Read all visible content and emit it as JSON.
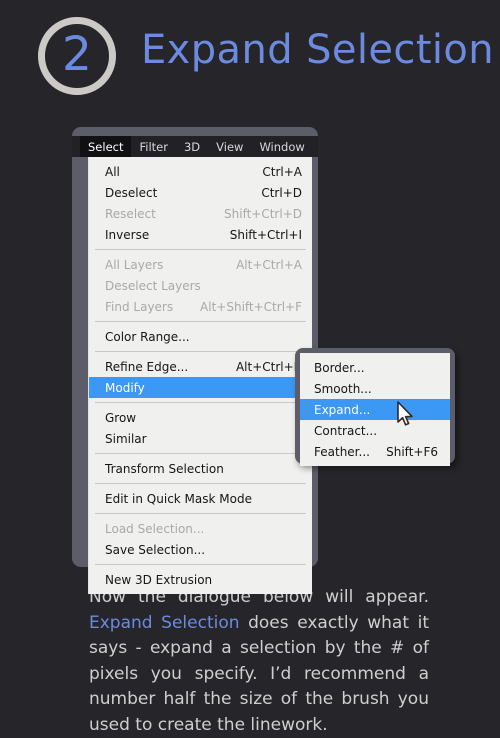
{
  "header": {
    "step_number": "2",
    "title": "Expand Selection",
    "accent_color": "#6c8be0",
    "ring_color": "#cccac6"
  },
  "window": {
    "menubar": [
      {
        "label": "Select",
        "active": true
      },
      {
        "label": "Filter",
        "active": false
      },
      {
        "label": "3D",
        "active": false
      },
      {
        "label": "View",
        "active": false
      },
      {
        "label": "Window",
        "active": false
      }
    ],
    "menu": {
      "groups": [
        {
          "items": [
            {
              "label": "All",
              "accel": "Ctrl+A",
              "disabled": false,
              "highlight": false,
              "submenu": false
            },
            {
              "label": "Deselect",
              "accel": "Ctrl+D",
              "disabled": false,
              "highlight": false,
              "submenu": false
            },
            {
              "label": "Reselect",
              "accel": "Shift+Ctrl+D",
              "disabled": true,
              "highlight": false,
              "submenu": false
            },
            {
              "label": "Inverse",
              "accel": "Shift+Ctrl+I",
              "disabled": false,
              "highlight": false,
              "submenu": false
            }
          ]
        },
        {
          "items": [
            {
              "label": "All Layers",
              "accel": "Alt+Ctrl+A",
              "disabled": true,
              "highlight": false,
              "submenu": false
            },
            {
              "label": "Deselect Layers",
              "accel": "",
              "disabled": true,
              "highlight": false,
              "submenu": false
            },
            {
              "label": "Find Layers",
              "accel": "Alt+Shift+Ctrl+F",
              "disabled": true,
              "highlight": false,
              "submenu": false
            }
          ]
        },
        {
          "items": [
            {
              "label": "Color Range...",
              "accel": "",
              "disabled": false,
              "highlight": false,
              "submenu": false
            }
          ]
        },
        {
          "items": [
            {
              "label": "Refine Edge...",
              "accel": "Alt+Ctrl+R",
              "disabled": false,
              "highlight": false,
              "submenu": false
            },
            {
              "label": "Modify",
              "accel": "",
              "disabled": false,
              "highlight": true,
              "submenu": true
            }
          ]
        },
        {
          "items": [
            {
              "label": "Grow",
              "accel": "",
              "disabled": false,
              "highlight": false,
              "submenu": false
            },
            {
              "label": "Similar",
              "accel": "",
              "disabled": false,
              "highlight": false,
              "submenu": false
            }
          ]
        },
        {
          "items": [
            {
              "label": "Transform Selection",
              "accel": "",
              "disabled": false,
              "highlight": false,
              "submenu": false
            }
          ]
        },
        {
          "items": [
            {
              "label": "Edit in Quick Mask Mode",
              "accel": "",
              "disabled": false,
              "highlight": false,
              "submenu": false
            }
          ]
        },
        {
          "items": [
            {
              "label": "Load Selection...",
              "accel": "",
              "disabled": true,
              "highlight": false,
              "submenu": false
            },
            {
              "label": "Save Selection...",
              "accel": "",
              "disabled": false,
              "highlight": false,
              "submenu": false
            }
          ]
        },
        {
          "items": [
            {
              "label": "New 3D Extrusion",
              "accel": "",
              "disabled": false,
              "highlight": false,
              "submenu": false
            }
          ]
        }
      ]
    },
    "submenu": {
      "items": [
        {
          "label": "Border...",
          "accel": "",
          "disabled": false,
          "highlight": false,
          "submenu": false
        },
        {
          "label": "Smooth...",
          "accel": "",
          "disabled": false,
          "highlight": false,
          "submenu": false
        },
        {
          "label": "Expand...",
          "accel": "",
          "disabled": false,
          "highlight": true,
          "submenu": false
        },
        {
          "label": "Contract...",
          "accel": "",
          "disabled": false,
          "highlight": false,
          "submenu": false
        },
        {
          "label": "Feather...",
          "accel": "Shift+F6",
          "disabled": false,
          "highlight": false,
          "submenu": false
        }
      ]
    },
    "highlight_color": "#3c98f5"
  },
  "caption": {
    "line1": "Now the dialogue below will appear. ",
    "keyword": "Expand Selection",
    "line2": " does exactly what it says - expand a selection by the # of pixels you specify. I’d recommend a number half the size of the brush you used to create the linework."
  }
}
